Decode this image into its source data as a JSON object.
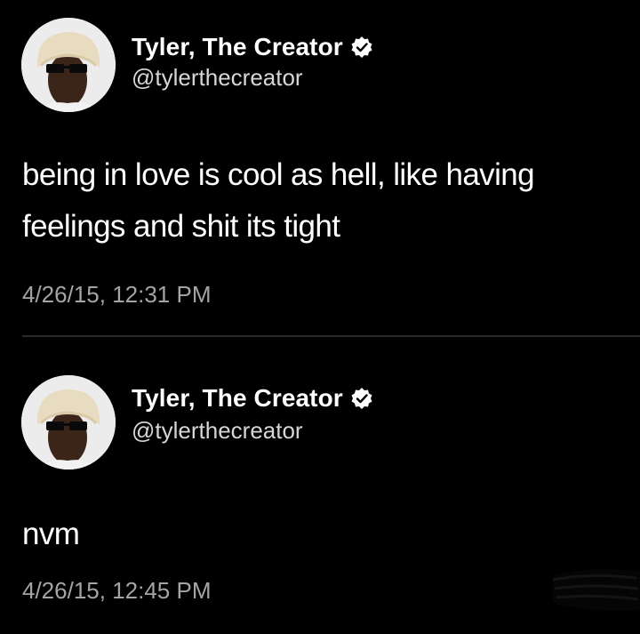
{
  "tweets": [
    {
      "display_name": "Tyler, The Creator",
      "handle": "@tylerthecreator",
      "text": "being in love is cool as hell, like having feelings and shit its tight",
      "timestamp": "4/26/15, 12:31 PM",
      "verified": true
    },
    {
      "display_name": "Tyler, The Creator",
      "handle": "@tylerthecreator",
      "text": "nvm",
      "timestamp": "4/26/15, 12:45 PM",
      "verified": true
    }
  ],
  "icons": {
    "avatar": "avatar-icon",
    "verified": "verified-badge-icon"
  },
  "colors": {
    "background": "#000000",
    "name": "#ffffff",
    "handle": "#d6d6d6",
    "timestamp": "#a4a4a4",
    "divider": "#2a2a2a"
  }
}
